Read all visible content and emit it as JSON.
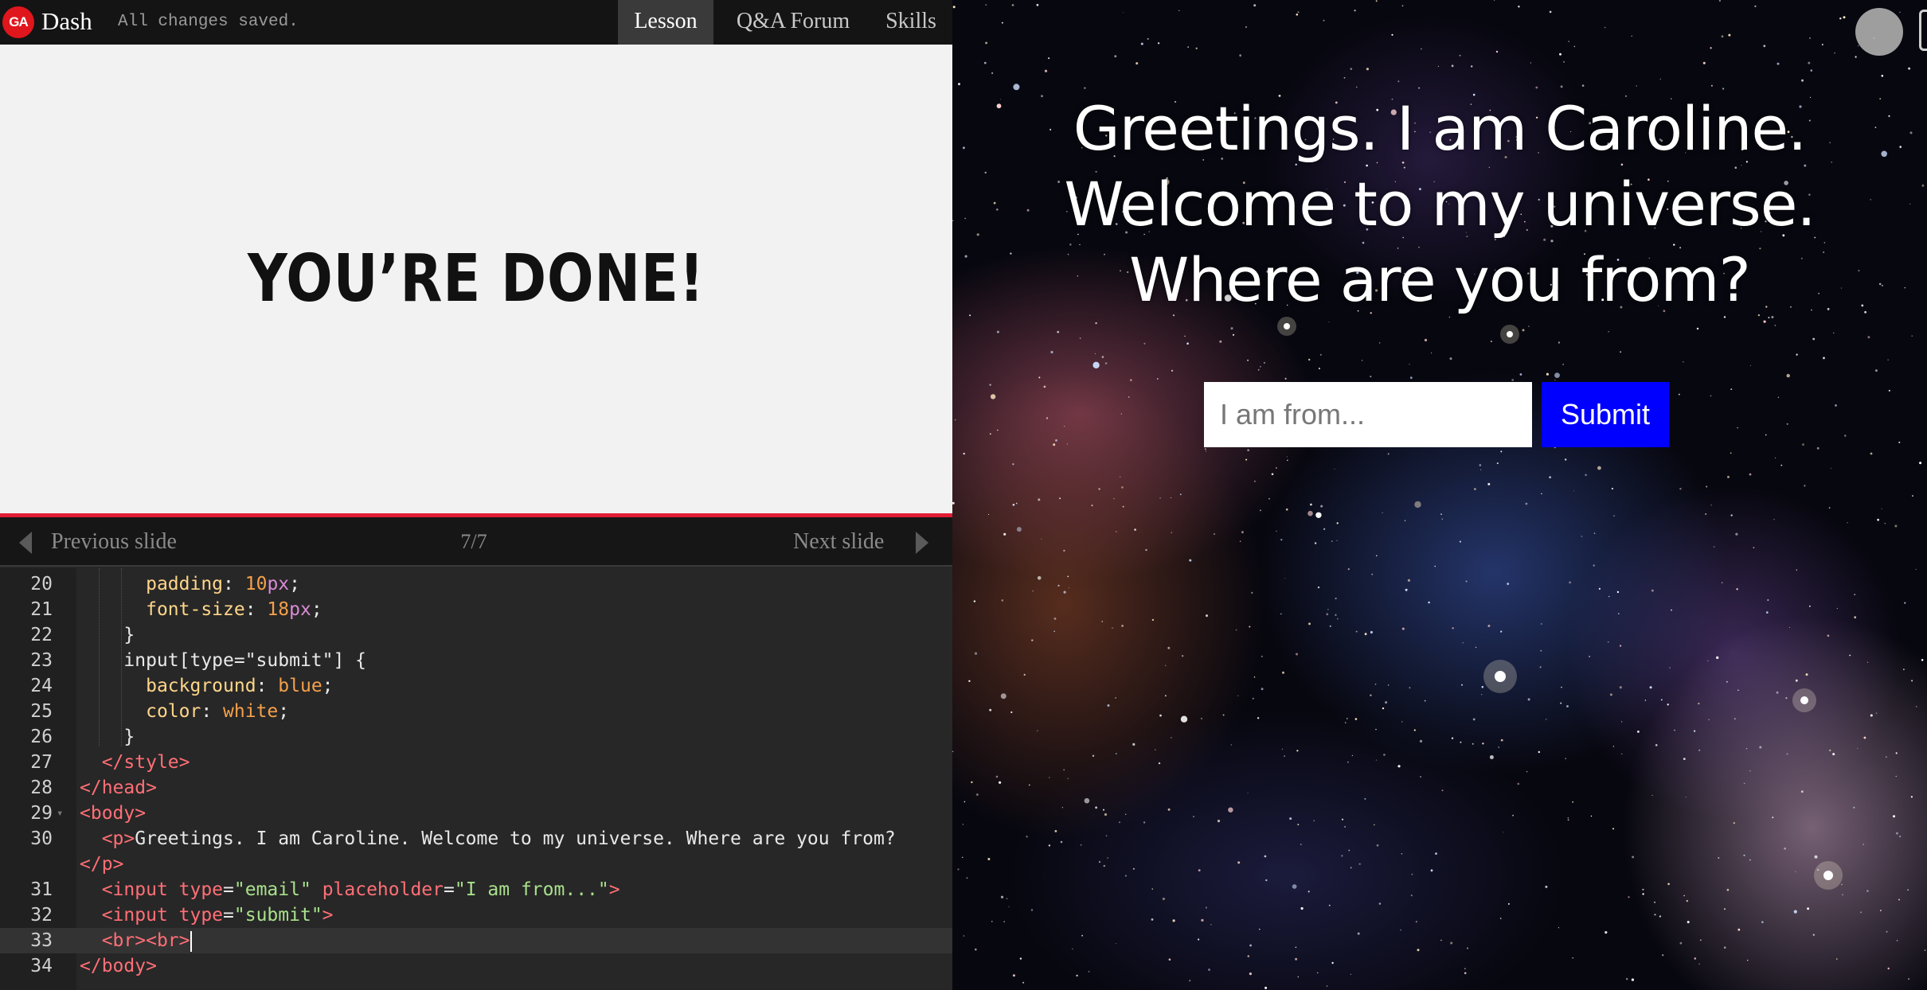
{
  "topbar": {
    "logo_text": "GA",
    "app_name": "Dash",
    "save_status": "All changes saved.",
    "tabs": [
      {
        "label": "Lesson",
        "active": true
      },
      {
        "label": "Q&A Forum",
        "active": false
      },
      {
        "label": "Skills",
        "active": false
      }
    ]
  },
  "slide": {
    "heading": "YOU’RE DONE!"
  },
  "slide_nav": {
    "prev_label": "Previous slide",
    "counter": "7/7",
    "next_label": "Next slide"
  },
  "editor": {
    "active_line": "33",
    "lines": [
      {
        "num": "20",
        "tokens": [
          [
            "      ",
            "plain"
          ],
          [
            "padding",
            "prop"
          ],
          [
            ": ",
            "plain"
          ],
          [
            "10",
            "num"
          ],
          [
            "px",
            "unit"
          ],
          [
            ";",
            "plain"
          ]
        ]
      },
      {
        "num": "21",
        "tokens": [
          [
            "      ",
            "plain"
          ],
          [
            "font-size",
            "prop"
          ],
          [
            ": ",
            "plain"
          ],
          [
            "18",
            "num"
          ],
          [
            "px",
            "unit"
          ],
          [
            ";",
            "plain"
          ]
        ]
      },
      {
        "num": "22",
        "tokens": [
          [
            "    }",
            "plain"
          ]
        ]
      },
      {
        "num": "23",
        "tokens": [
          [
            "    input[type=\"submit\"] {",
            "plain"
          ]
        ]
      },
      {
        "num": "24",
        "tokens": [
          [
            "      ",
            "plain"
          ],
          [
            "background",
            "prop"
          ],
          [
            ": ",
            "plain"
          ],
          [
            "blue",
            "val"
          ],
          [
            ";",
            "plain"
          ]
        ]
      },
      {
        "num": "25",
        "tokens": [
          [
            "      ",
            "plain"
          ],
          [
            "color",
            "prop"
          ],
          [
            ": ",
            "plain"
          ],
          [
            "white",
            "val"
          ],
          [
            ";",
            "plain"
          ]
        ]
      },
      {
        "num": "26",
        "tokens": [
          [
            "    }",
            "plain"
          ]
        ]
      },
      {
        "num": "27",
        "tokens": [
          [
            "  ",
            "plain"
          ],
          [
            "</style>",
            "tag"
          ]
        ]
      },
      {
        "num": "28",
        "tokens": [
          [
            "</head>",
            "tag"
          ]
        ]
      },
      {
        "num": "29",
        "tokens": [
          [
            "<body>",
            "tag"
          ]
        ]
      },
      {
        "num": "30",
        "tokens": [
          [
            "  ",
            "plain"
          ],
          [
            "<p>",
            "tag"
          ],
          [
            "Greetings. I am Caroline. Welcome to my universe. Where are you from?",
            "plain"
          ]
        ]
      },
      {
        "num": "",
        "tokens": [
          [
            "</p>",
            "tag"
          ]
        ]
      },
      {
        "num": "31",
        "tokens": [
          [
            "  ",
            "plain"
          ],
          [
            "<input ",
            "tag"
          ],
          [
            "type",
            "attr"
          ],
          [
            "=",
            "plain"
          ],
          [
            "\"email\"",
            "str"
          ],
          [
            " ",
            "plain"
          ],
          [
            "placeholder",
            "attr"
          ],
          [
            "=",
            "plain"
          ],
          [
            "\"I am from...\"",
            "str"
          ],
          [
            ">",
            "tag"
          ]
        ]
      },
      {
        "num": "32",
        "tokens": [
          [
            "  ",
            "plain"
          ],
          [
            "<input ",
            "tag"
          ],
          [
            "type",
            "attr"
          ],
          [
            "=",
            "plain"
          ],
          [
            "\"submit\"",
            "str"
          ],
          [
            ">",
            "tag"
          ]
        ]
      },
      {
        "num": "33",
        "tokens": [
          [
            "  ",
            "plain"
          ],
          [
            "<br><br>",
            "tag"
          ]
        ]
      },
      {
        "num": "34",
        "tokens": [
          [
            "</body>",
            "tag"
          ]
        ]
      }
    ]
  },
  "preview": {
    "greeting": "Greetings. I am Caroline. Welcome to my universe. Where are you from?",
    "input_placeholder": "I am from...",
    "submit_label": "Submit",
    "submit_color": "#0000ff",
    "avatar_icon": "avatar-circle",
    "device_icon": "mobile-phone-icon"
  },
  "colors": {
    "accent_red": "#e11d35",
    "editor_bg": "#272727",
    "topbar_bg": "#141414"
  }
}
